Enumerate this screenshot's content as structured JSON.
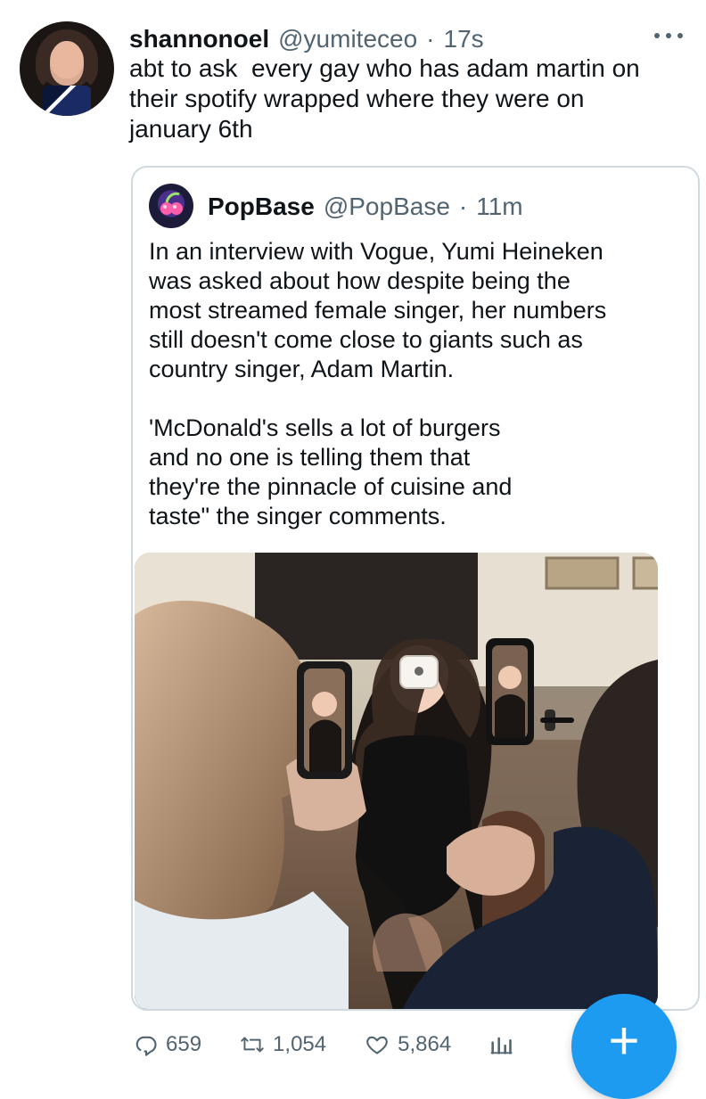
{
  "tweet": {
    "author_name": "shannonoel",
    "author_handle": "@yumiteceo",
    "separator": "·",
    "time": "17s",
    "text": "abt to ask  every gay who has adam martin on\ntheir spotify wrapped where they were on\njanuary 6th"
  },
  "quote": {
    "author_name": "PopBase",
    "author_handle": "@PopBase",
    "separator": "·",
    "time": "11m",
    "text": "In an interview with Vogue, Yumi Heineken\nwas asked about how despite being the\nmost streamed female singer, her numbers\nstill doesn't come close to giants such as\ncountry singer, Adam Martin.\n\n'McDonald's sells a lot of burgers\nand no one is telling them that\nthey're the pinnacle of cuisine and\ntaste\" the singer comments.",
    "image": {
      "alt_semantic": "photo-woman-being-photographed-with-phones"
    }
  },
  "actions": {
    "reply_count": "659",
    "retweet_count": "1,054",
    "like_count": "5,864"
  },
  "fab": {
    "label": "+"
  },
  "colors": {
    "accent": "#1d9bf0",
    "secondary_text": "#536471",
    "border": "#cfd9de",
    "text": "#0f1419"
  },
  "icons": {
    "more": "more-dots-icon",
    "reply": "reply-icon",
    "retweet": "retweet-icon",
    "like": "heart-icon",
    "analytics": "analytics-icon",
    "compose": "plus-icon"
  }
}
